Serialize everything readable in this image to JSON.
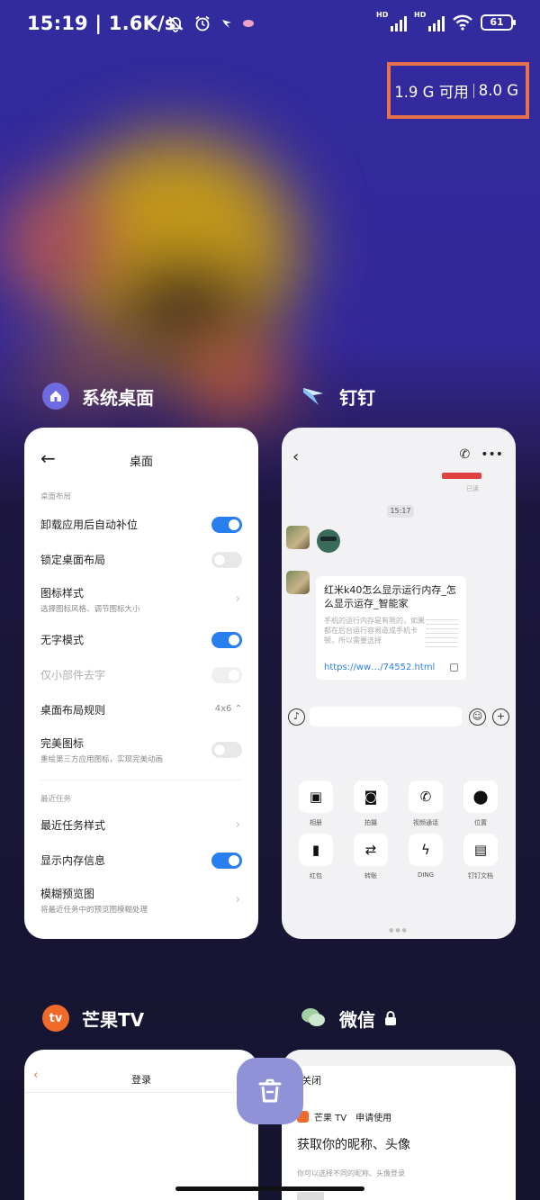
{
  "status": {
    "time": "15:19",
    "speed": "1.6K/s",
    "hd1": "HD",
    "hd2": "HD",
    "battery": "61"
  },
  "memory": {
    "available": "1.9 G 可用",
    "total": "8.0 G"
  },
  "apps": {
    "desktop": {
      "name": "系统桌面"
    },
    "dingtalk": {
      "name": "钉钉"
    },
    "mango": {
      "name": "芒果TV"
    },
    "wechat": {
      "name": "微信"
    }
  },
  "settings": {
    "title": "桌面",
    "section_layout": "桌面布局",
    "rows": [
      {
        "label": "卸载应用后自动补位"
      },
      {
        "label": "锁定桌面布局"
      },
      {
        "label": "图标样式",
        "sub": "选择图标风格、调节图标大小"
      },
      {
        "label": "无字模式"
      },
      {
        "label": "仅小部件去字"
      },
      {
        "label": "桌面布局规则",
        "value": "4x6"
      },
      {
        "label": "完美图标",
        "sub": "重绘第三方应用图标，实现完美动画"
      }
    ],
    "section_recent": "最近任务",
    "rows2": [
      {
        "label": "最近任务样式"
      },
      {
        "label": "显示内存信息"
      },
      {
        "label": "模糊预览图",
        "sub": "将最近任务中的预览图模糊处理"
      }
    ]
  },
  "ding": {
    "read": "已读",
    "time": "15:17",
    "msg_title": "红米k40怎么显示运行内存_怎么显示运存_智能家",
    "msg_desc": "手机的运行内存是有限的，如果都在后台运行容易造成手机卡顿，所以需要选择",
    "msg_link": "https://ww…/74552.html",
    "tools": [
      "相册",
      "拍摄",
      "视频通话",
      "位置",
      "红包",
      "转账",
      "DING",
      "钉钉文档"
    ]
  },
  "mango_card": {
    "title": "登录"
  },
  "wechat_card": {
    "close": "关闭",
    "app": "芒果 TV",
    "apply": "申请使用",
    "heading": "获取你的昵称、头像",
    "desc": "你可以选择不同的昵称、头像登录"
  }
}
